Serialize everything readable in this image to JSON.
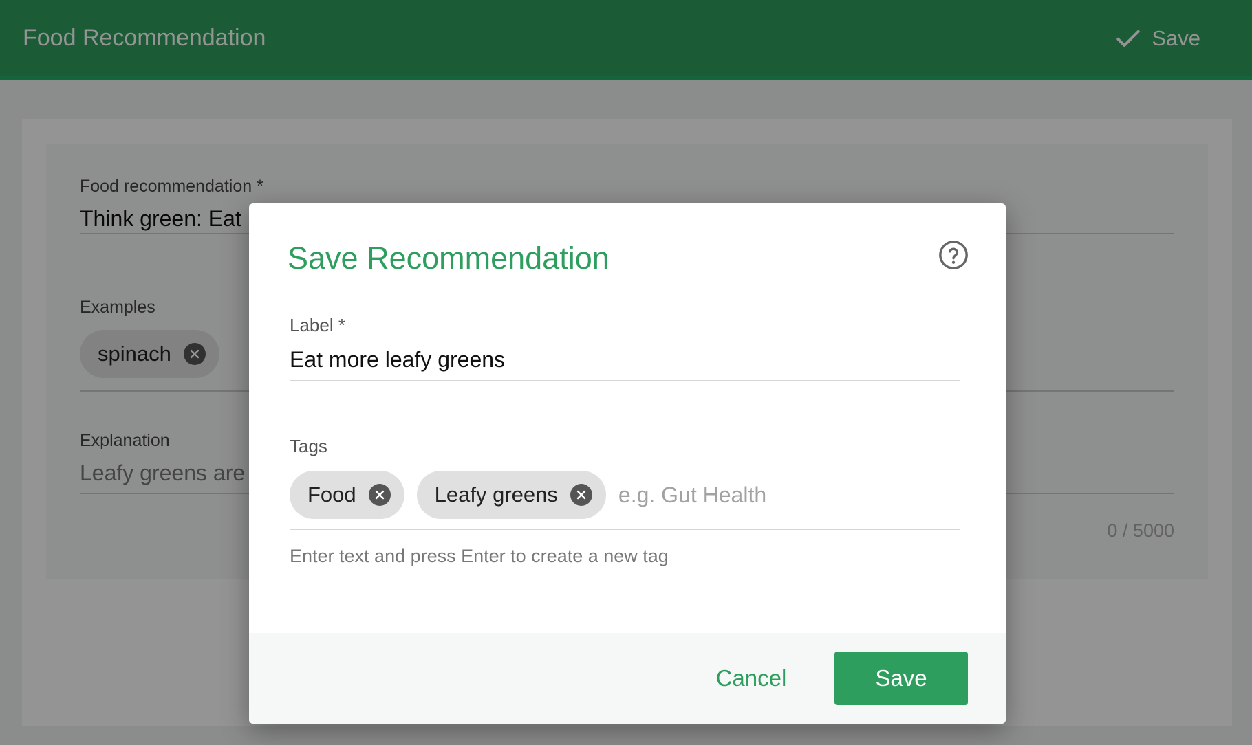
{
  "app_bar": {
    "title": "Food Recommendation",
    "save_label": "Save",
    "save_icon": "check-icon"
  },
  "form": {
    "food_recommendation": {
      "label": "Food recommendation *",
      "value": "Think green: Eat"
    },
    "examples": {
      "label": "Examples",
      "chips": [
        "spinach"
      ]
    },
    "explanation": {
      "label": "Explanation",
      "value": "Leafy greens are",
      "counter": "0 / 5000"
    }
  },
  "dialog": {
    "title": "Save Recommendation",
    "help_icon": "help-circle-icon",
    "label_field": {
      "label": "Label *",
      "value": "Eat more leafy greens"
    },
    "tags_field": {
      "label": "Tags",
      "tags": [
        "Food",
        "Leafy greens"
      ],
      "placeholder": "e.g. Gut Health",
      "hint": "Enter text and press Enter to create a new tag"
    },
    "cancel_label": "Cancel",
    "save_label": "Save"
  },
  "colors": {
    "app_bar": "#2f9e5e",
    "accent": "#2e9e5e",
    "chip": "#e0e0e0",
    "scrim": "rgba(0,0,0,0.42)"
  }
}
